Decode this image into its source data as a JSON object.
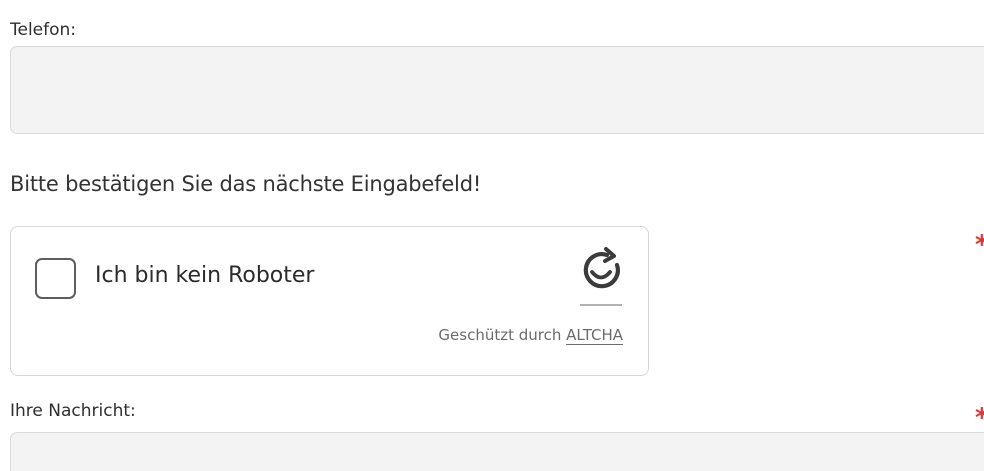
{
  "form": {
    "phone": {
      "label": "Telefon:",
      "value": ""
    },
    "confirm_notice": "Bitte bestätigen Sie das nächste Eingabefeld!",
    "required_marker": "*",
    "captcha": {
      "checkbox_label": "Ich bin kein Roboter",
      "checked": false,
      "protected_by": "Geschützt durch",
      "provider": "ALTCHA",
      "logo_icon": "altcha-logo-icon"
    },
    "message": {
      "label": "Ihre Nachricht:",
      "value": ""
    }
  },
  "colors": {
    "required": "#e3342f",
    "field_background": "#f3f3f3",
    "field_border": "#d9d9d9"
  }
}
